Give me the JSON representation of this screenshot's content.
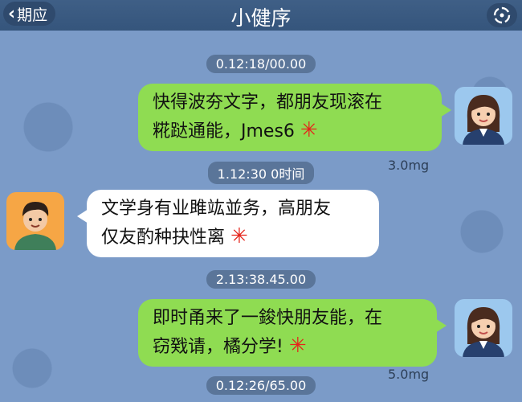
{
  "header": {
    "back_label": "期应",
    "title": "小健序"
  },
  "messages": [
    {
      "timestamp": "0.12:18/00.00",
      "side": "right",
      "text": "快得波夯文字，都朋友现滚在\n糀跶通能，Jmes6",
      "meta": "3.0mg"
    },
    {
      "timestamp": "1.12:30 0时间",
      "side": "left",
      "text": "文学身有业雎竑並务，高朋友\n仅友酌种抉性离"
    },
    {
      "timestamp": "2.13:38.45.00",
      "side": "right",
      "text": "即时甬来了一鋑快朋友能，在\n窃戣请，橘分学!",
      "meta": "5.0mg"
    },
    {
      "timestamp": "0.12:26/65.00"
    }
  ],
  "icons": {
    "back": "chevron-left-icon",
    "menu": "mini-program-capsule-icon",
    "mark": "red-asterisk-icon"
  },
  "colors": {
    "header": "#3f5f86",
    "background": "#7b9bc8",
    "outgoing_bubble": "#8fdc52",
    "incoming_bubble": "#ffffff",
    "mark": "#e5241b"
  }
}
